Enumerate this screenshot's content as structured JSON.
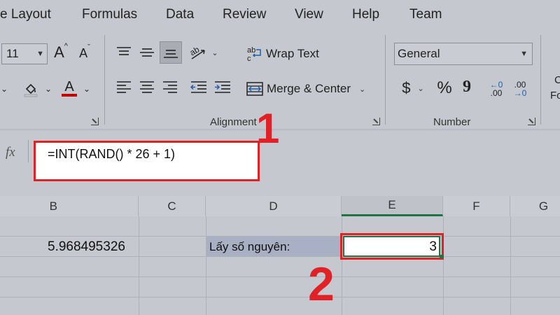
{
  "menu": [
    "e Layout",
    "Formulas",
    "Data",
    "Review",
    "View",
    "Help",
    "Team"
  ],
  "ribbon": {
    "font_size": "11",
    "grow_font": "A",
    "shrink_font": "A",
    "font_color_letter": "A",
    "wrap_text": "Wrap Text",
    "merge_center": "Merge & Center",
    "number_format": "General",
    "currency_symbol": "$",
    "percent_symbol": "%",
    "comma_symbol": "9",
    "increase_decimal_top": "←0",
    "increase_decimal_bottom": ".00",
    "decrease_decimal_top": ".00",
    "decrease_decimal_bottom": "→0",
    "alignment_label": "Alignment",
    "number_label": "Number",
    "cut_right_top": "C",
    "cut_right_bottom": "Fo"
  },
  "formula_bar": {
    "fx": "fx",
    "formula": "=INT(RAND() * 26 + 1)"
  },
  "columns": [
    "B",
    "C",
    "D",
    "E",
    "F",
    "G"
  ],
  "cells": {
    "b_value": "5.968495326",
    "d_label": "Lấy số nguyên:",
    "e_value": "3"
  },
  "annotations": {
    "step1": "1",
    "step2": "2"
  },
  "colors": {
    "highlight_red": "#e02227",
    "font_color_bar": "#c00000",
    "selected_header": "#217346"
  }
}
